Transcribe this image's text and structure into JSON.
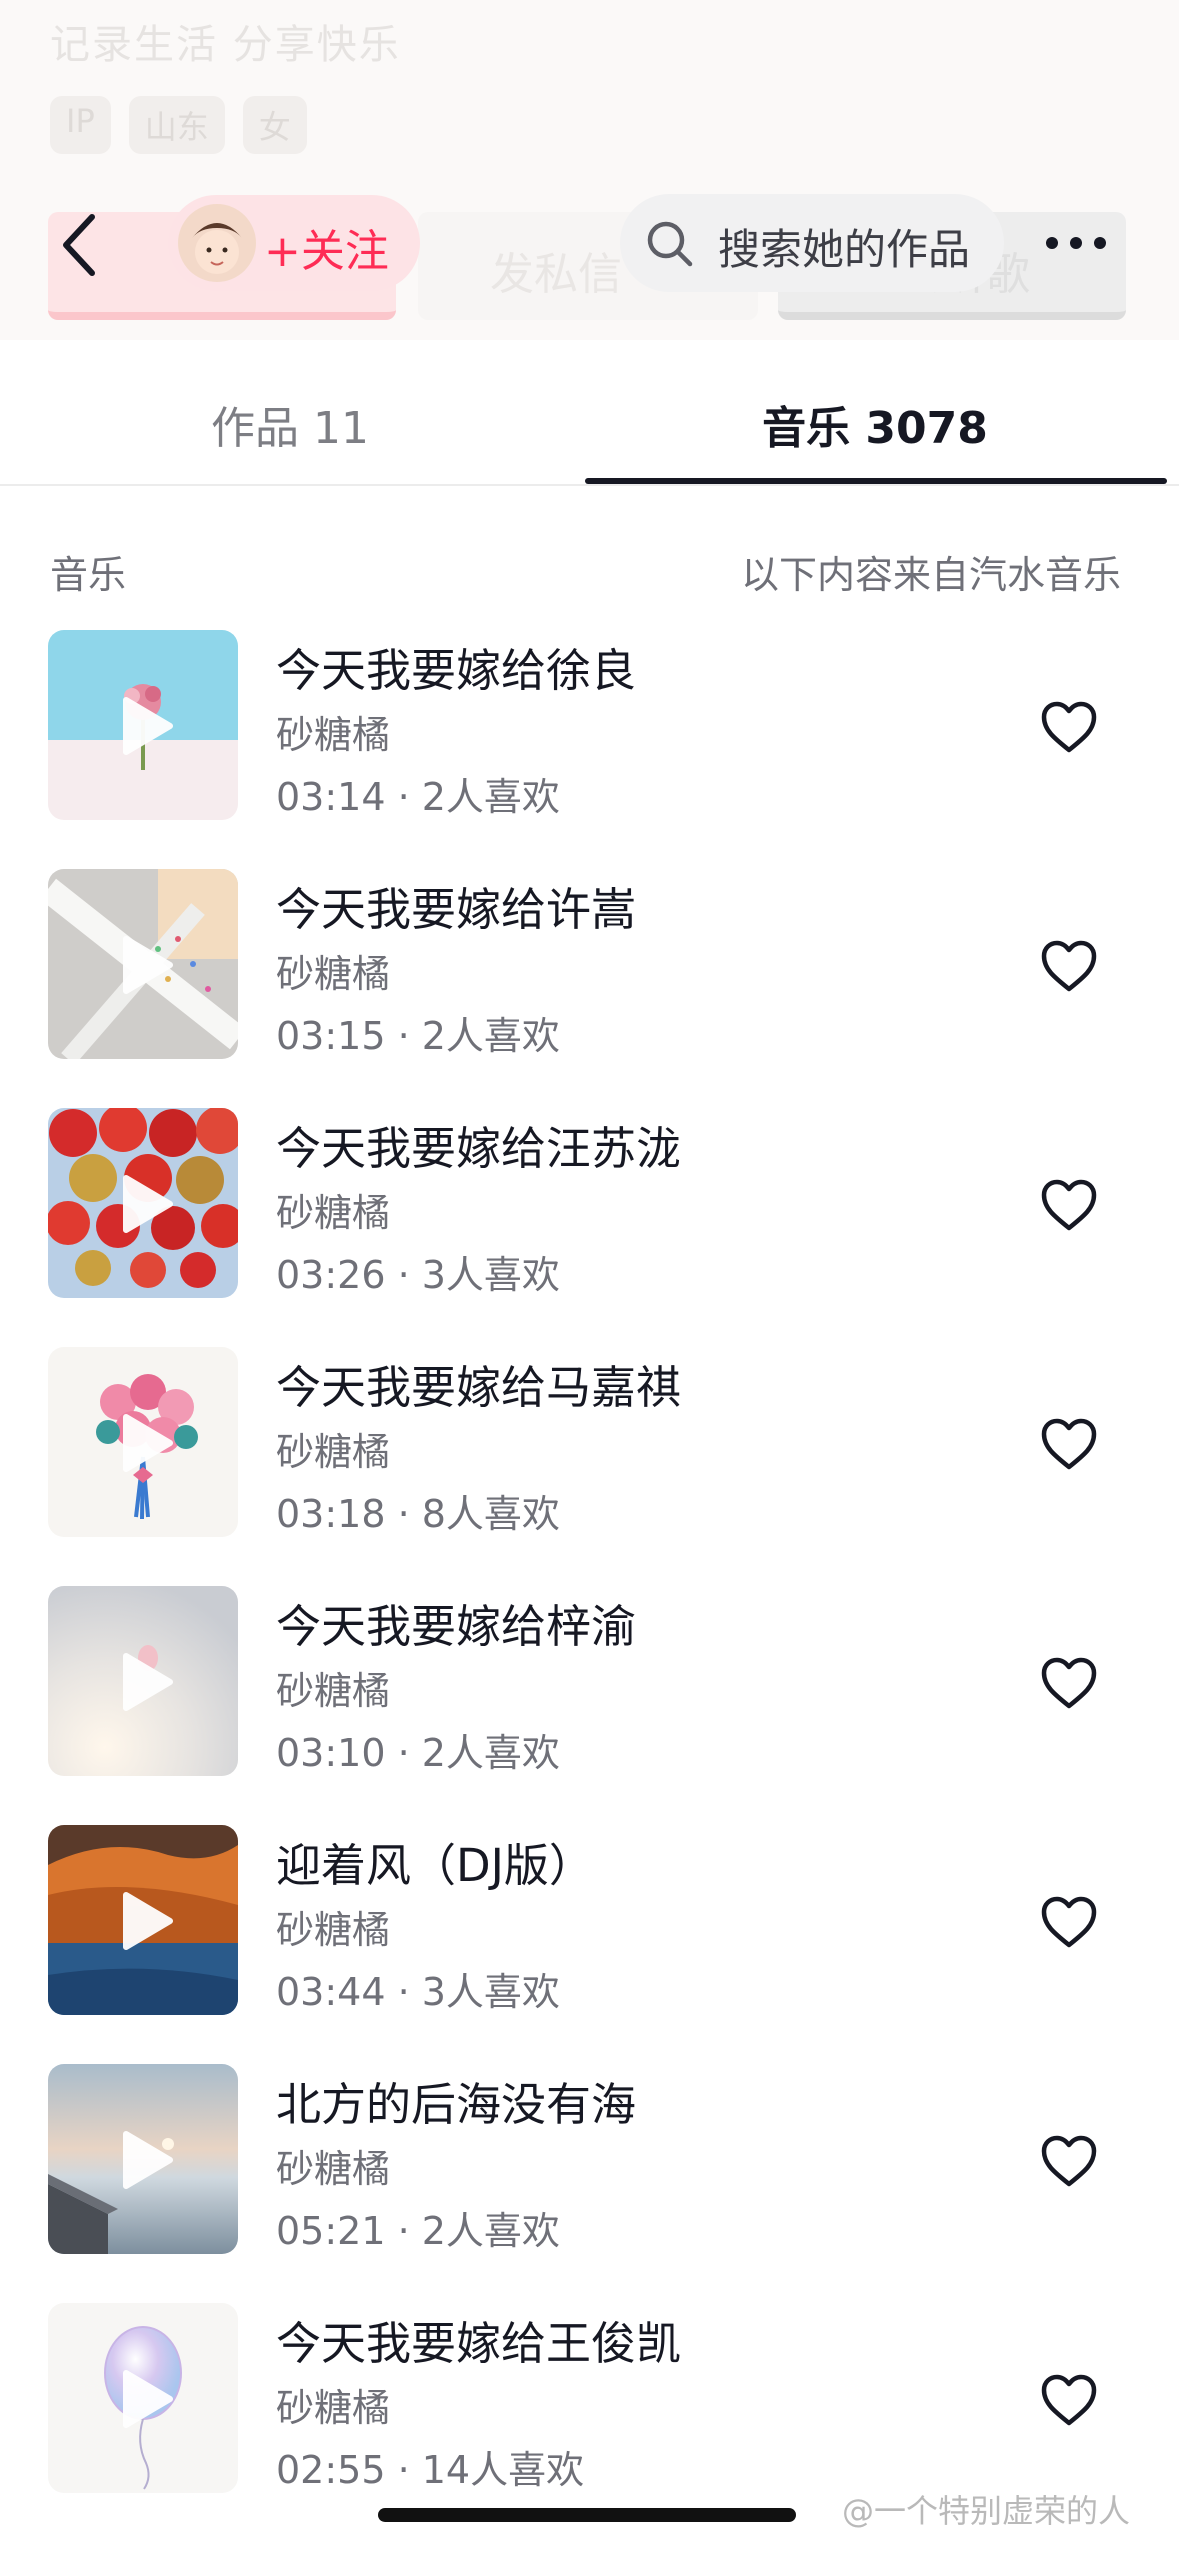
{
  "background": {
    "bio": "记录生活    分享快乐",
    "tags": [
      "IP",
      "山东",
      "女"
    ],
    "buttons": [
      "发私信",
      "去听歌"
    ]
  },
  "top_bar": {
    "back_icon": "chevron-left-icon",
    "follow_label": "+关注",
    "search_placeholder": "搜索她的作品",
    "more_icon": "more-dots-icon"
  },
  "tabs": [
    {
      "label": "作品 11",
      "active": false
    },
    {
      "label": "音乐 3078",
      "active": true
    }
  ],
  "section": {
    "title": "音乐",
    "source_note": "以下内容来自汽水音乐"
  },
  "songs": [
    {
      "title": "今天我要嫁给徐良",
      "artist": "砂糖橘",
      "meta": "03:14 · 2人喜欢"
    },
    {
      "title": "今天我要嫁给许嵩",
      "artist": "砂糖橘",
      "meta": "03:15 · 2人喜欢"
    },
    {
      "title": "今天我要嫁给汪苏泷",
      "artist": "砂糖橘",
      "meta": "03:26 · 3人喜欢"
    },
    {
      "title": "今天我要嫁给马嘉祺",
      "artist": "砂糖橘",
      "meta": "03:18 · 8人喜欢"
    },
    {
      "title": "今天我要嫁给梓渝",
      "artist": "砂糖橘",
      "meta": "03:10 · 2人喜欢"
    },
    {
      "title": "迎着风（DJ版）",
      "artist": "砂糖橘",
      "meta": "03:44 · 3人喜欢"
    },
    {
      "title": "北方的后海没有海",
      "artist": "砂糖橘",
      "meta": "05:21 · 2人喜欢"
    },
    {
      "title": "今天我要嫁给王俊凯",
      "artist": "砂糖橘",
      "meta": "02:55 · 14人喜欢"
    }
  ],
  "watermark": "@一个特别虚荣的人",
  "colors": {
    "accent": "#fe2c55",
    "text_primary": "#161823",
    "text_secondary": "#6f7078"
  }
}
